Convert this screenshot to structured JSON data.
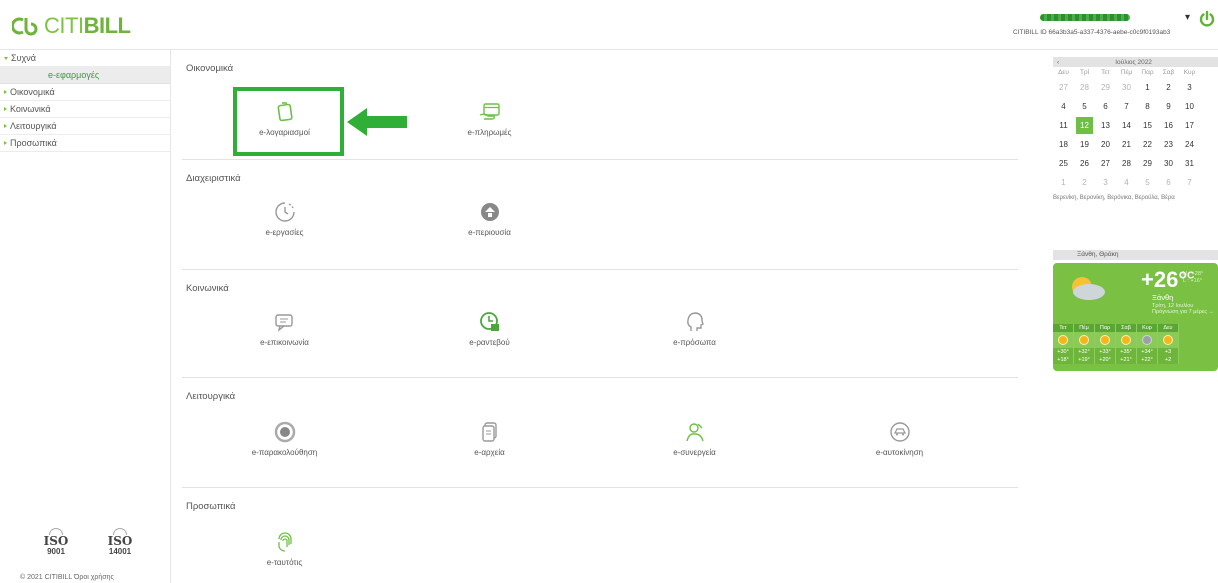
{
  "header": {
    "brand_citi": "CITI",
    "brand_bill": "BILL",
    "user_id": "CITIBILL ID 66a3b3a5-a337-4376-aebe-c0c9f0193ab3",
    "user_menu_caret": "▾"
  },
  "sidebar": {
    "items": [
      {
        "label": "Συχνά",
        "open": true
      },
      {
        "label": "Οικονομικά"
      },
      {
        "label": "Κοινωνικά"
      },
      {
        "label": "Λειτουργικά"
      },
      {
        "label": "Προσωπικά"
      }
    ],
    "sub_item": "e-εφαρμογές",
    "iso": [
      {
        "word": "ISO",
        "num": "9001"
      },
      {
        "word": "ISO",
        "num": "14001"
      }
    ],
    "footer_copyright": "© 2021 CITIBILL",
    "footer_terms": "Όροι χρήσης"
  },
  "sections": [
    {
      "title": "Οικονομικά",
      "apps": [
        {
          "label": "e-λογαριασμοί",
          "icon": "bill-document-icon"
        },
        {
          "label": "e-πληρωμές",
          "icon": "payment-card-icon"
        }
      ]
    },
    {
      "title": "Διαχειριστικά",
      "apps": [
        {
          "label": "e-εργασίες",
          "icon": "clock-icon"
        },
        {
          "label": "e-περιουσία",
          "icon": "property-icon"
        }
      ]
    },
    {
      "title": "Κοινωνικά",
      "apps": [
        {
          "label": "e-επικοινωνία",
          "icon": "chat-icon"
        },
        {
          "label": "e-ραντεβού",
          "icon": "appointment-icon"
        },
        {
          "label": "e-πρόσωπα",
          "icon": "person-head-icon"
        }
      ]
    },
    {
      "title": "Λειτουργικά",
      "apps": [
        {
          "label": "e-παρακολούθηση",
          "icon": "monitoring-icon"
        },
        {
          "label": "e-αρχεία",
          "icon": "files-icon"
        },
        {
          "label": "e-συνεργεία",
          "icon": "workshop-icon"
        },
        {
          "label": "e-αυτοκίνηση",
          "icon": "car-icon"
        }
      ]
    },
    {
      "title": "Προσωπικά",
      "apps": [
        {
          "label": "e-ταυτότις",
          "icon": "fingerprint-icon"
        }
      ]
    }
  ],
  "calendar": {
    "prev": "‹",
    "month": "Ιούλιος 2022",
    "dows": [
      "Δευ",
      "Τρί",
      "Τετ",
      "Πέμ",
      "Παρ",
      "Σαβ",
      "Κυρ"
    ],
    "weeks": [
      [
        "27",
        "28",
        "29",
        "30",
        "1",
        "2",
        "3"
      ],
      [
        "4",
        "5",
        "6",
        "7",
        "8",
        "9",
        "10"
      ],
      [
        "11",
        "12",
        "13",
        "14",
        "15",
        "16",
        "17"
      ],
      [
        "18",
        "19",
        "20",
        "21",
        "22",
        "23",
        "24"
      ],
      [
        "25",
        "26",
        "27",
        "28",
        "29",
        "30",
        "31"
      ],
      [
        "1",
        "2",
        "3",
        "4",
        "5",
        "6",
        "7"
      ]
    ],
    "today": "12",
    "namedays": "Βερενίκη, Βερονίκη, Βερόνικα, Βεροϋλα, Βέρα"
  },
  "weather": {
    "location_select": "Ξάνθη, Θράκη",
    "temp": "+26°",
    "unit": "C",
    "hi": "H : +28°",
    "lo": "L : +16°",
    "city": "Ξάνθη",
    "date": "Τρίτη, 12 Ιουλίου",
    "forecast": "Πρόγνωση για 7 μέρες →",
    "days": [
      {
        "name": "Τετ",
        "hi": "+30°",
        "lo": "+18°"
      },
      {
        "name": "Πέμ",
        "hi": "+32°",
        "lo": "+19°"
      },
      {
        "name": "Παρ",
        "hi": "+33°",
        "lo": "+20°"
      },
      {
        "name": "Σαβ",
        "hi": "+35°",
        "lo": "+21°"
      },
      {
        "name": "Κυρ",
        "hi": "+34°",
        "lo": "+22°"
      },
      {
        "name": "Δευ",
        "hi": "+3",
        "lo": "+2"
      }
    ]
  },
  "colors": {
    "accent": "#7dc242",
    "highlight": "#2fae38"
  }
}
